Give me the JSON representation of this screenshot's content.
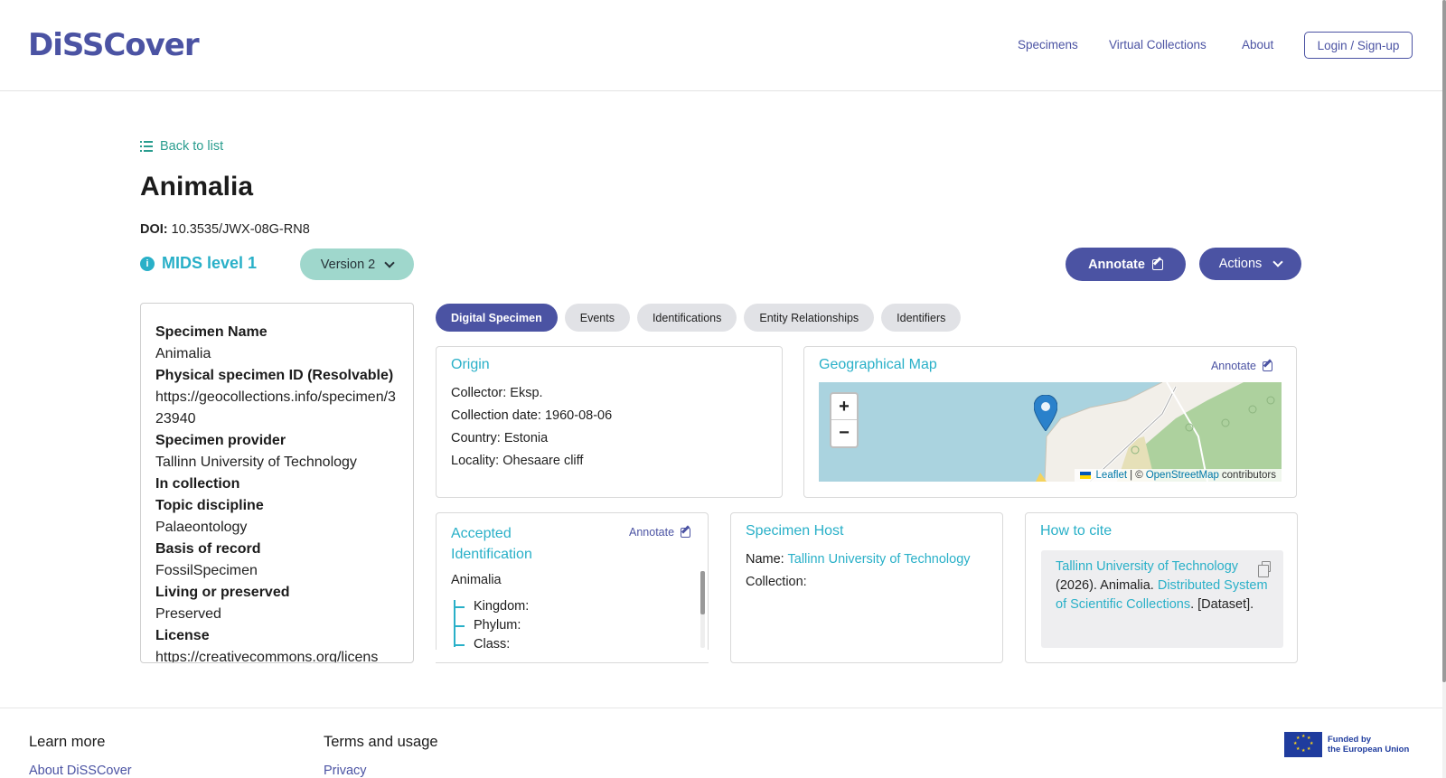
{
  "header": {
    "logo": "DiSSCover",
    "nav": [
      "Specimens",
      "Virtual Collections",
      "About"
    ],
    "login_label": "Login / Sign-up"
  },
  "page": {
    "back_label": "Back to list",
    "title": "Animalia",
    "doi_label": "DOI:",
    "doi_value": "10.3535/JWX-08G-RN8",
    "mids_label": "MIDS level 1",
    "version_label": "Version 2",
    "annotate_label": "Annotate",
    "actions_label": "Actions"
  },
  "left_panel": [
    {
      "label": "Specimen Name",
      "value": "Animalia"
    },
    {
      "label": "Physical specimen ID (Resolvable)",
      "value": "https://geocollections.info/specimen/323940"
    },
    {
      "label": "Specimen provider",
      "value": "Tallinn University of Technology"
    },
    {
      "label": "In collection",
      "value": ""
    },
    {
      "label": "Topic discipline",
      "value": "Palaeontology"
    },
    {
      "label": "Basis of record",
      "value": "FossilSpecimen"
    },
    {
      "label": "Living or preserved",
      "value": "Preserved"
    },
    {
      "label": "License",
      "value": "https://creativecommons.org/licens"
    }
  ],
  "tabs": [
    "Digital Specimen",
    "Events",
    "Identifications",
    "Entity Relationships",
    "Identifiers"
  ],
  "origin": {
    "title": "Origin",
    "collector_label": "Collector:",
    "collector": "Eksp.",
    "date_label": "Collection date:",
    "date": "1960-08-06",
    "country_label": "Country:",
    "country": "Estonia",
    "locality_label": "Locality:",
    "locality": "Ohesaare cliff"
  },
  "map": {
    "title": "Geographical Map",
    "annotate_label": "Annotate",
    "zoom_in": "+",
    "zoom_out": "−",
    "attribution_leaflet": "Leaflet",
    "attribution_sep": "| ©",
    "attribution_osm": "OpenStreetMap",
    "attribution_tail": "contributors"
  },
  "accepted_identification": {
    "title_line1": "Accepted",
    "title_line2": "Identification",
    "annotate_label": "Annotate",
    "name": "Animalia",
    "ranks": [
      "Kingdom:",
      "Phylum:",
      "Class:"
    ]
  },
  "specimen_host": {
    "title": "Specimen Host",
    "name_label": "Name:",
    "name": "Tallinn University of Technology",
    "collection_label": "Collection:"
  },
  "how_to_cite": {
    "title": "How to cite",
    "part1": "Tallinn University of Technology",
    "part2": " (2026). Animalia. ",
    "part3": "Distributed System of Scientific Collections",
    "part4": ". [Dataset]."
  },
  "footer": {
    "learn_more": "Learn more",
    "about_link": "About DiSSCover",
    "terms": "Terms and usage",
    "privacy": "Privacy",
    "eu_line1": "Funded by",
    "eu_line2": "the European Union"
  },
  "colors": {
    "brand": "#4b53a3",
    "accent": "#29b0c8",
    "version_pill": "#9fd7cc"
  }
}
